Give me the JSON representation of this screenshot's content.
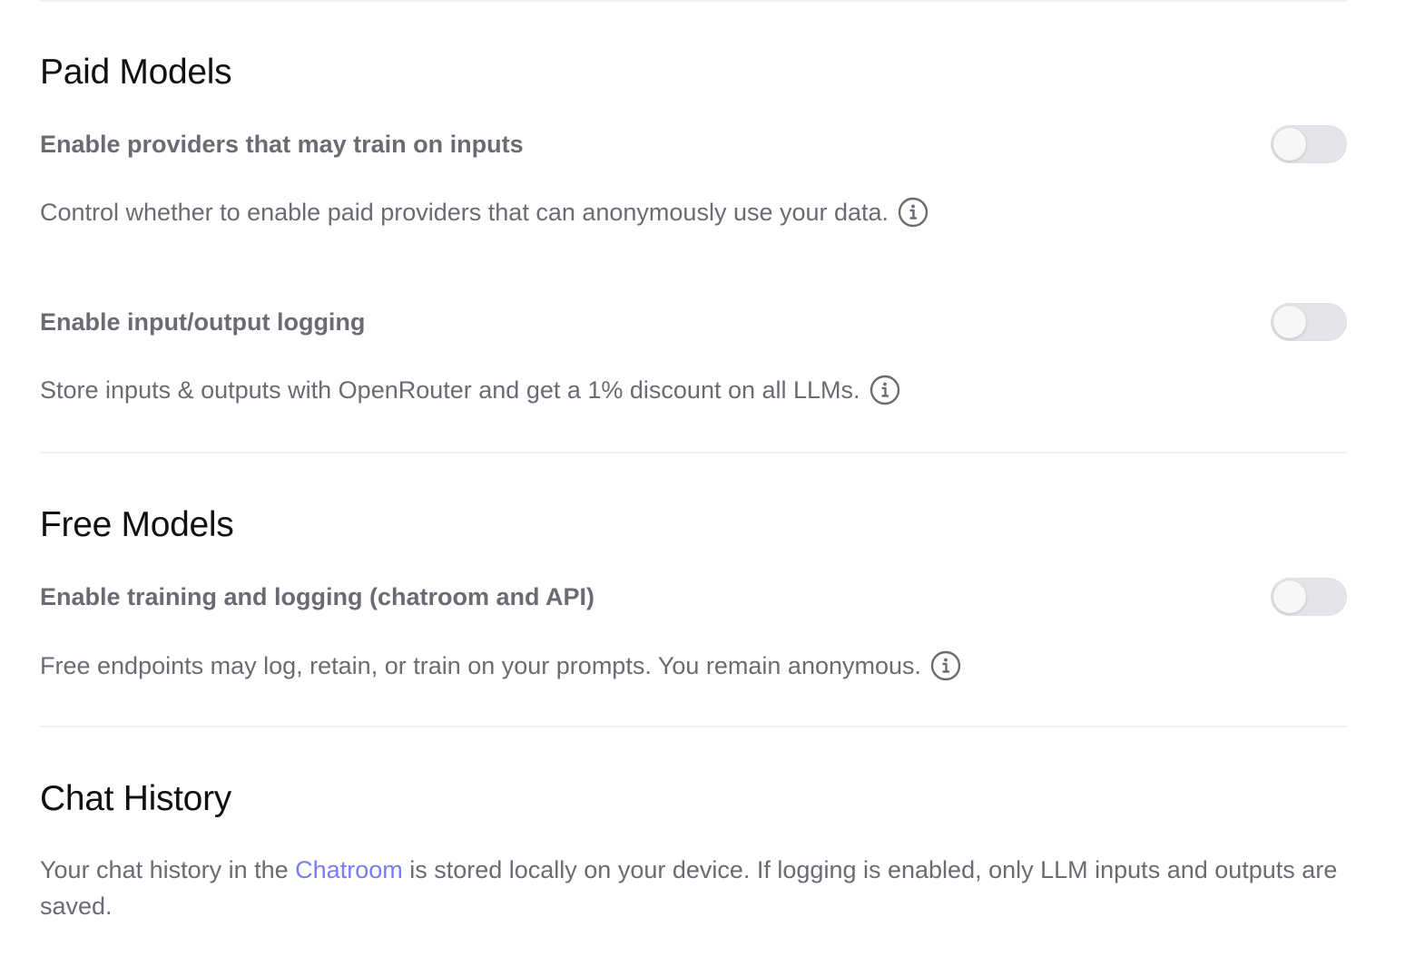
{
  "paid_models": {
    "title": "Paid Models",
    "settings": [
      {
        "label": "Enable providers that may train on inputs",
        "description": "Control whether to enable paid providers that can anonymously use your data.",
        "enabled": false
      },
      {
        "label": "Enable input/output logging",
        "description": "Store inputs & outputs with OpenRouter and get a 1% discount on all LLMs.",
        "enabled": false
      }
    ]
  },
  "free_models": {
    "title": "Free Models",
    "settings": [
      {
        "label": "Enable training and logging (chatroom and API)",
        "description": "Free endpoints may log, retain, or train on your prompts. You remain anonymous.",
        "enabled": false
      }
    ]
  },
  "chat_history": {
    "title": "Chat History",
    "text_before": "Your chat history in the ",
    "link_label": "Chatroom",
    "text_after": " is stored locally on your device. If logging is enabled, only LLM inputs and outputs are saved."
  },
  "colors": {
    "heading": "#111114",
    "body_text": "#6b6b73",
    "link": "#7c7cf0",
    "toggle_off": "#e5e5e9",
    "divider": "#f0f0f2"
  },
  "icons": {
    "info": "info-circle-icon"
  }
}
